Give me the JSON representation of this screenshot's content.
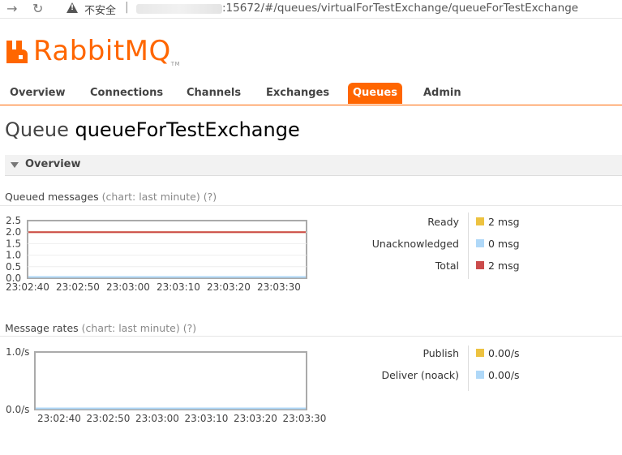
{
  "browser": {
    "insecure_label": "不安全",
    "separator": "|",
    "url": ":15672/#/queues/virtualForTestExchange/queueForTestExchange"
  },
  "logo": {
    "text": "RabbitMQ",
    "tm": "TM",
    "color": "#ff6600"
  },
  "tabs": [
    {
      "label": "Overview"
    },
    {
      "label": "Connections"
    },
    {
      "label": "Channels"
    },
    {
      "label": "Exchanges"
    },
    {
      "label": "Queues",
      "active": true
    },
    {
      "label": "Admin"
    }
  ],
  "page": {
    "prefix": "Queue",
    "name": "queueForTestExchange"
  },
  "section": {
    "title": "Overview"
  },
  "queued": {
    "label": "Queued messages",
    "chart_note": "(chart: last minute)",
    "help": "(?)",
    "legend": [
      {
        "label": "Ready",
        "value": "2 msg",
        "color": "#edc240"
      },
      {
        "label": "Unacknowledged",
        "value": "0 msg",
        "color": "#afd8f8"
      },
      {
        "label": "Total",
        "value": "2 msg",
        "color": "#cb4b4b"
      }
    ]
  },
  "rates": {
    "label": "Message rates",
    "chart_note": "(chart: last minute)",
    "help": "(?)",
    "legend": [
      {
        "label": "Publish",
        "value": "0.00/s",
        "color": "#edc240"
      },
      {
        "label": "Deliver (noack)",
        "value": "0.00/s",
        "color": "#afd8f8"
      }
    ]
  },
  "chart_data": [
    {
      "type": "line",
      "title": "Queued messages",
      "x": [
        "23:02:40",
        "23:02:50",
        "23:03:00",
        "23:03:10",
        "23:03:20",
        "23:03:30"
      ],
      "yticks": [
        "2.5",
        "2.0",
        "1.5",
        "1.0",
        "0.5",
        "0.0"
      ],
      "ylim": [
        0,
        2.5
      ],
      "series": [
        {
          "name": "Ready",
          "color": "#edc240",
          "values": [
            2,
            2,
            2,
            2,
            2,
            2
          ]
        },
        {
          "name": "Unacknowledged",
          "color": "#afd8f8",
          "values": [
            0,
            0,
            0,
            0,
            0,
            0
          ]
        },
        {
          "name": "Total",
          "color": "#cb4b4b",
          "values": [
            2,
            2,
            2,
            2,
            2,
            2
          ]
        }
      ]
    },
    {
      "type": "line",
      "title": "Message rates",
      "x": [
        "23:02:40",
        "23:02:50",
        "23:03:00",
        "23:03:10",
        "23:03:20",
        "23:03:30"
      ],
      "yticks": [
        "1.0/s",
        "0.0/s"
      ],
      "ylim": [
        0,
        1
      ],
      "series": [
        {
          "name": "Publish",
          "color": "#edc240",
          "values": [
            0,
            0,
            0,
            0,
            0,
            0
          ]
        },
        {
          "name": "Deliver (noack)",
          "color": "#afd8f8",
          "values": [
            0,
            0,
            0,
            0,
            0,
            0
          ]
        }
      ]
    }
  ]
}
